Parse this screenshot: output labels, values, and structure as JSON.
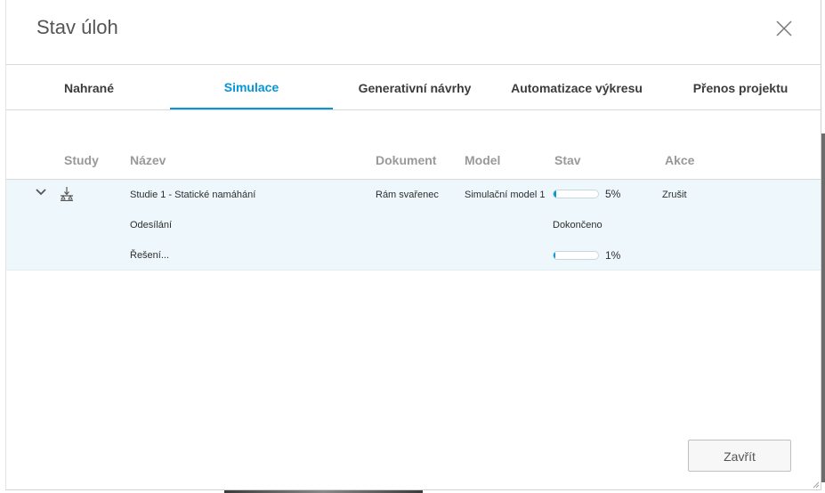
{
  "dialog": {
    "title": "Stav úloh",
    "close_icon": "close-icon",
    "close_button_label": "Zavřít"
  },
  "tabs": [
    {
      "label": "Nahrané",
      "active": false
    },
    {
      "label": "Simulace",
      "active": true
    },
    {
      "label": "Generativní návrhy",
      "active": false
    },
    {
      "label": "Automatizace výkresu",
      "active": false
    },
    {
      "label": "Přenos projektu",
      "active": false
    }
  ],
  "table": {
    "columns": [
      "Study",
      "Název",
      "Dokument",
      "Model",
      "Stav",
      "Akce"
    ],
    "job": {
      "expand_icon": "chevron-down-icon",
      "study_icon": "static-stress-icon",
      "name": "Studie 1 - Statické namáhání",
      "document": "Rám svařenec",
      "model": "Simulační model 1",
      "progress_percent": 5,
      "progress_label": "5%",
      "action": "Zrušit"
    },
    "subtasks": [
      {
        "name": "Odesílání",
        "status": "Dokončeno"
      },
      {
        "name": "Řešení...",
        "progress_percent": 1,
        "progress_label": "1%"
      }
    ]
  },
  "colors": {
    "accent": "#0696d7",
    "row_highlight": "#eef7fb",
    "header_text": "#999999"
  }
}
